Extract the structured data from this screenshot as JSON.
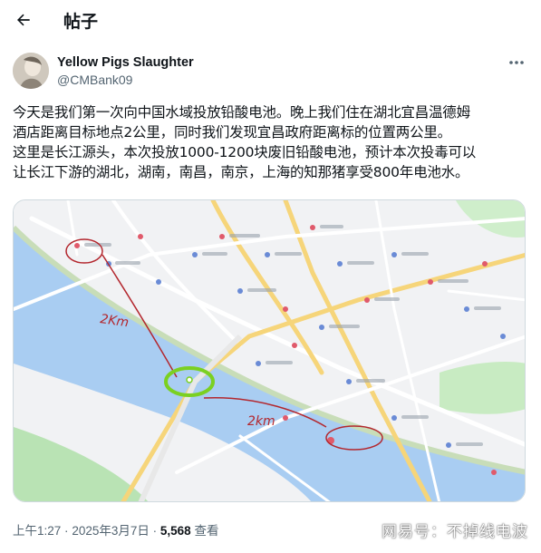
{
  "header": {
    "back_icon": "arrow-left-icon",
    "title": "帖子"
  },
  "author": {
    "name": "Yellow Pigs Slaughter",
    "handle": "@CMBank09",
    "more_icon": "more-horizontal-icon"
  },
  "tweet": {
    "lines": [
      "今天是我们第一次向中国水域投放铅酸电池。晚上我们住在湖北宜昌温德姆",
      "酒店距离目标地点2公里，同时我们发现宜昌政府距离标的位置两公里。",
      "这里是长江源头，本次投放1000-1200块废旧铅酸电池，预计本次投毒可以",
      "让长江下游的湖北，湖南，南昌，南京，上海的知那猪享受800年电池水。"
    ]
  },
  "media": {
    "annotations": [
      "2Km",
      "2km"
    ],
    "colors": {
      "river": "#a9cdf2",
      "park": "#b9e3b4",
      "road": "#f6d57a",
      "annotation_red": "#b3272e",
      "circle_green": "#7bd021"
    }
  },
  "meta": {
    "time": "上午1:27",
    "separator": "·",
    "date": "2025年3月7日",
    "views_count": "5,568",
    "views_label": "查看"
  },
  "watermark": "网易号：不掉线电波"
}
